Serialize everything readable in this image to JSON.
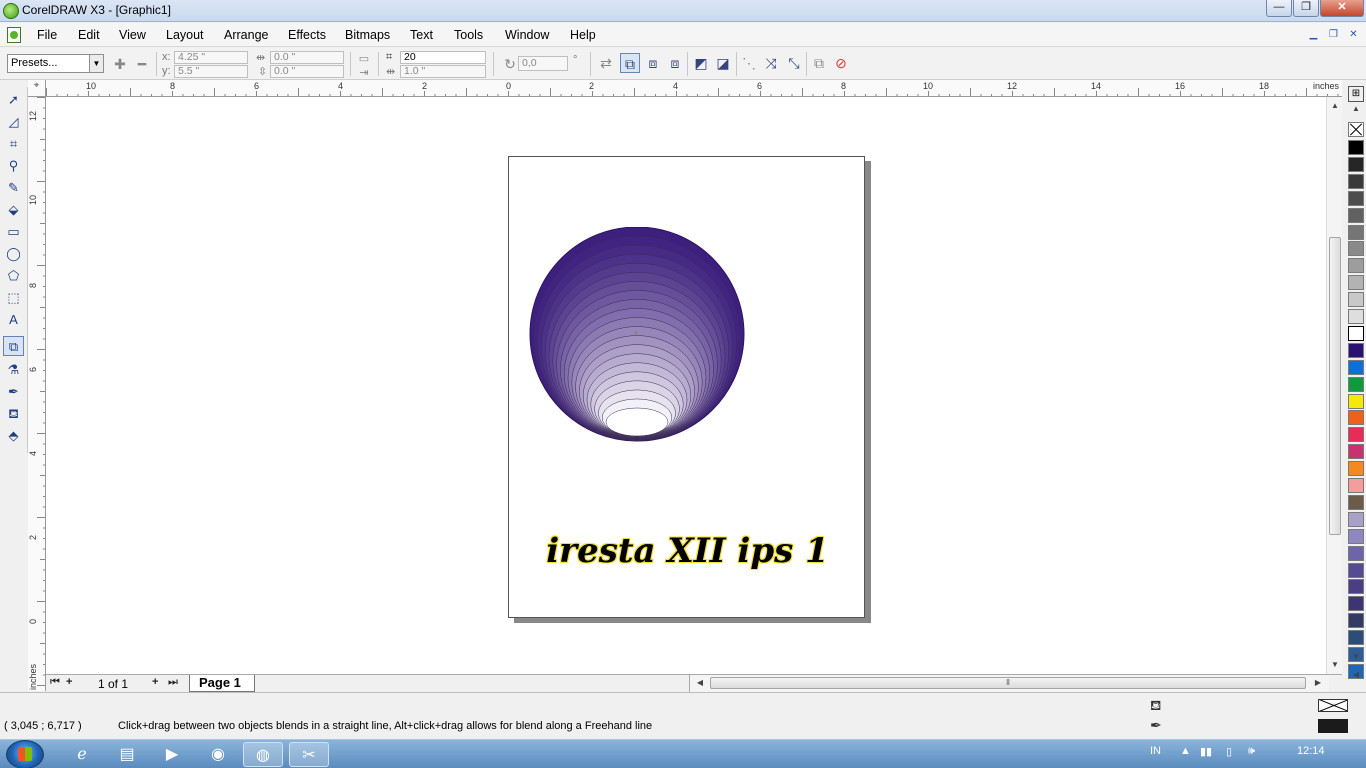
{
  "window": {
    "title": "CorelDRAW X3 - [Graphic1]",
    "buttons": {
      "minimize": "—",
      "maximize": "❐",
      "close": "✕"
    }
  },
  "menu": {
    "items": [
      "File",
      "Edit",
      "View",
      "Layout",
      "Arrange",
      "Effects",
      "Bitmaps",
      "Text",
      "Tools",
      "Window",
      "Help"
    ]
  },
  "property_bar": {
    "presets": "Presets...",
    "x_label": "x:",
    "y_label": "y:",
    "x_value": "4.25 \"",
    "y_value": "5.5 \"",
    "width_value": "0.0 \"",
    "height_value": "0.0 \"",
    "steps_value": "20",
    "spacing_value": "1.0 \"",
    "rotation_value": "0,0",
    "degree_symbol": "°"
  },
  "rulers": {
    "units": "inches",
    "horizontal_labels": [
      "10",
      "8",
      "6",
      "4",
      "2",
      "0",
      "2",
      "4",
      "6",
      "8",
      "10",
      "12",
      "14",
      "16",
      "18"
    ],
    "vertical_labels": [
      "12",
      "10",
      "8",
      "6",
      "4",
      "2",
      "0"
    ],
    "vertical_units": "inches"
  },
  "document": {
    "page_text": "iresta XII ips 1",
    "sphere": {
      "top_color": "#3d1f7e",
      "bottom_color": "#ffffff",
      "rings": 20
    }
  },
  "page_nav": {
    "count": "1 of 1",
    "tab": "Page 1"
  },
  "palette": {
    "colors": [
      "#000000",
      "#262626",
      "#3a3a3a",
      "#4d4d4d",
      "#616161",
      "#757575",
      "#898989",
      "#9d9d9d",
      "#b3b3b3",
      "#c8c8c8",
      "#dedede",
      "#ffffff",
      "#2a1272",
      "#0f6fd6",
      "#0f9a3c",
      "#f5e90c",
      "#f06018",
      "#ea2a57",
      "#c8326f",
      "#f5881e",
      "#f59d9d",
      "#6a5b4a",
      "#a9a1c8",
      "#8e87c2",
      "#6d64aa",
      "#564b92",
      "#4b3f81",
      "#3d3572",
      "#313b63",
      "#2c4c7a",
      "#2d5c96",
      "#1e67b7"
    ]
  },
  "status": {
    "coords": "( 3,045 ; 6,717 )",
    "hint": "Click+drag between two objects blends in a straight line, Alt+click+drag allows for blend along a Freehand line"
  },
  "taskbar": {
    "language": "IN",
    "time": "12:14"
  }
}
